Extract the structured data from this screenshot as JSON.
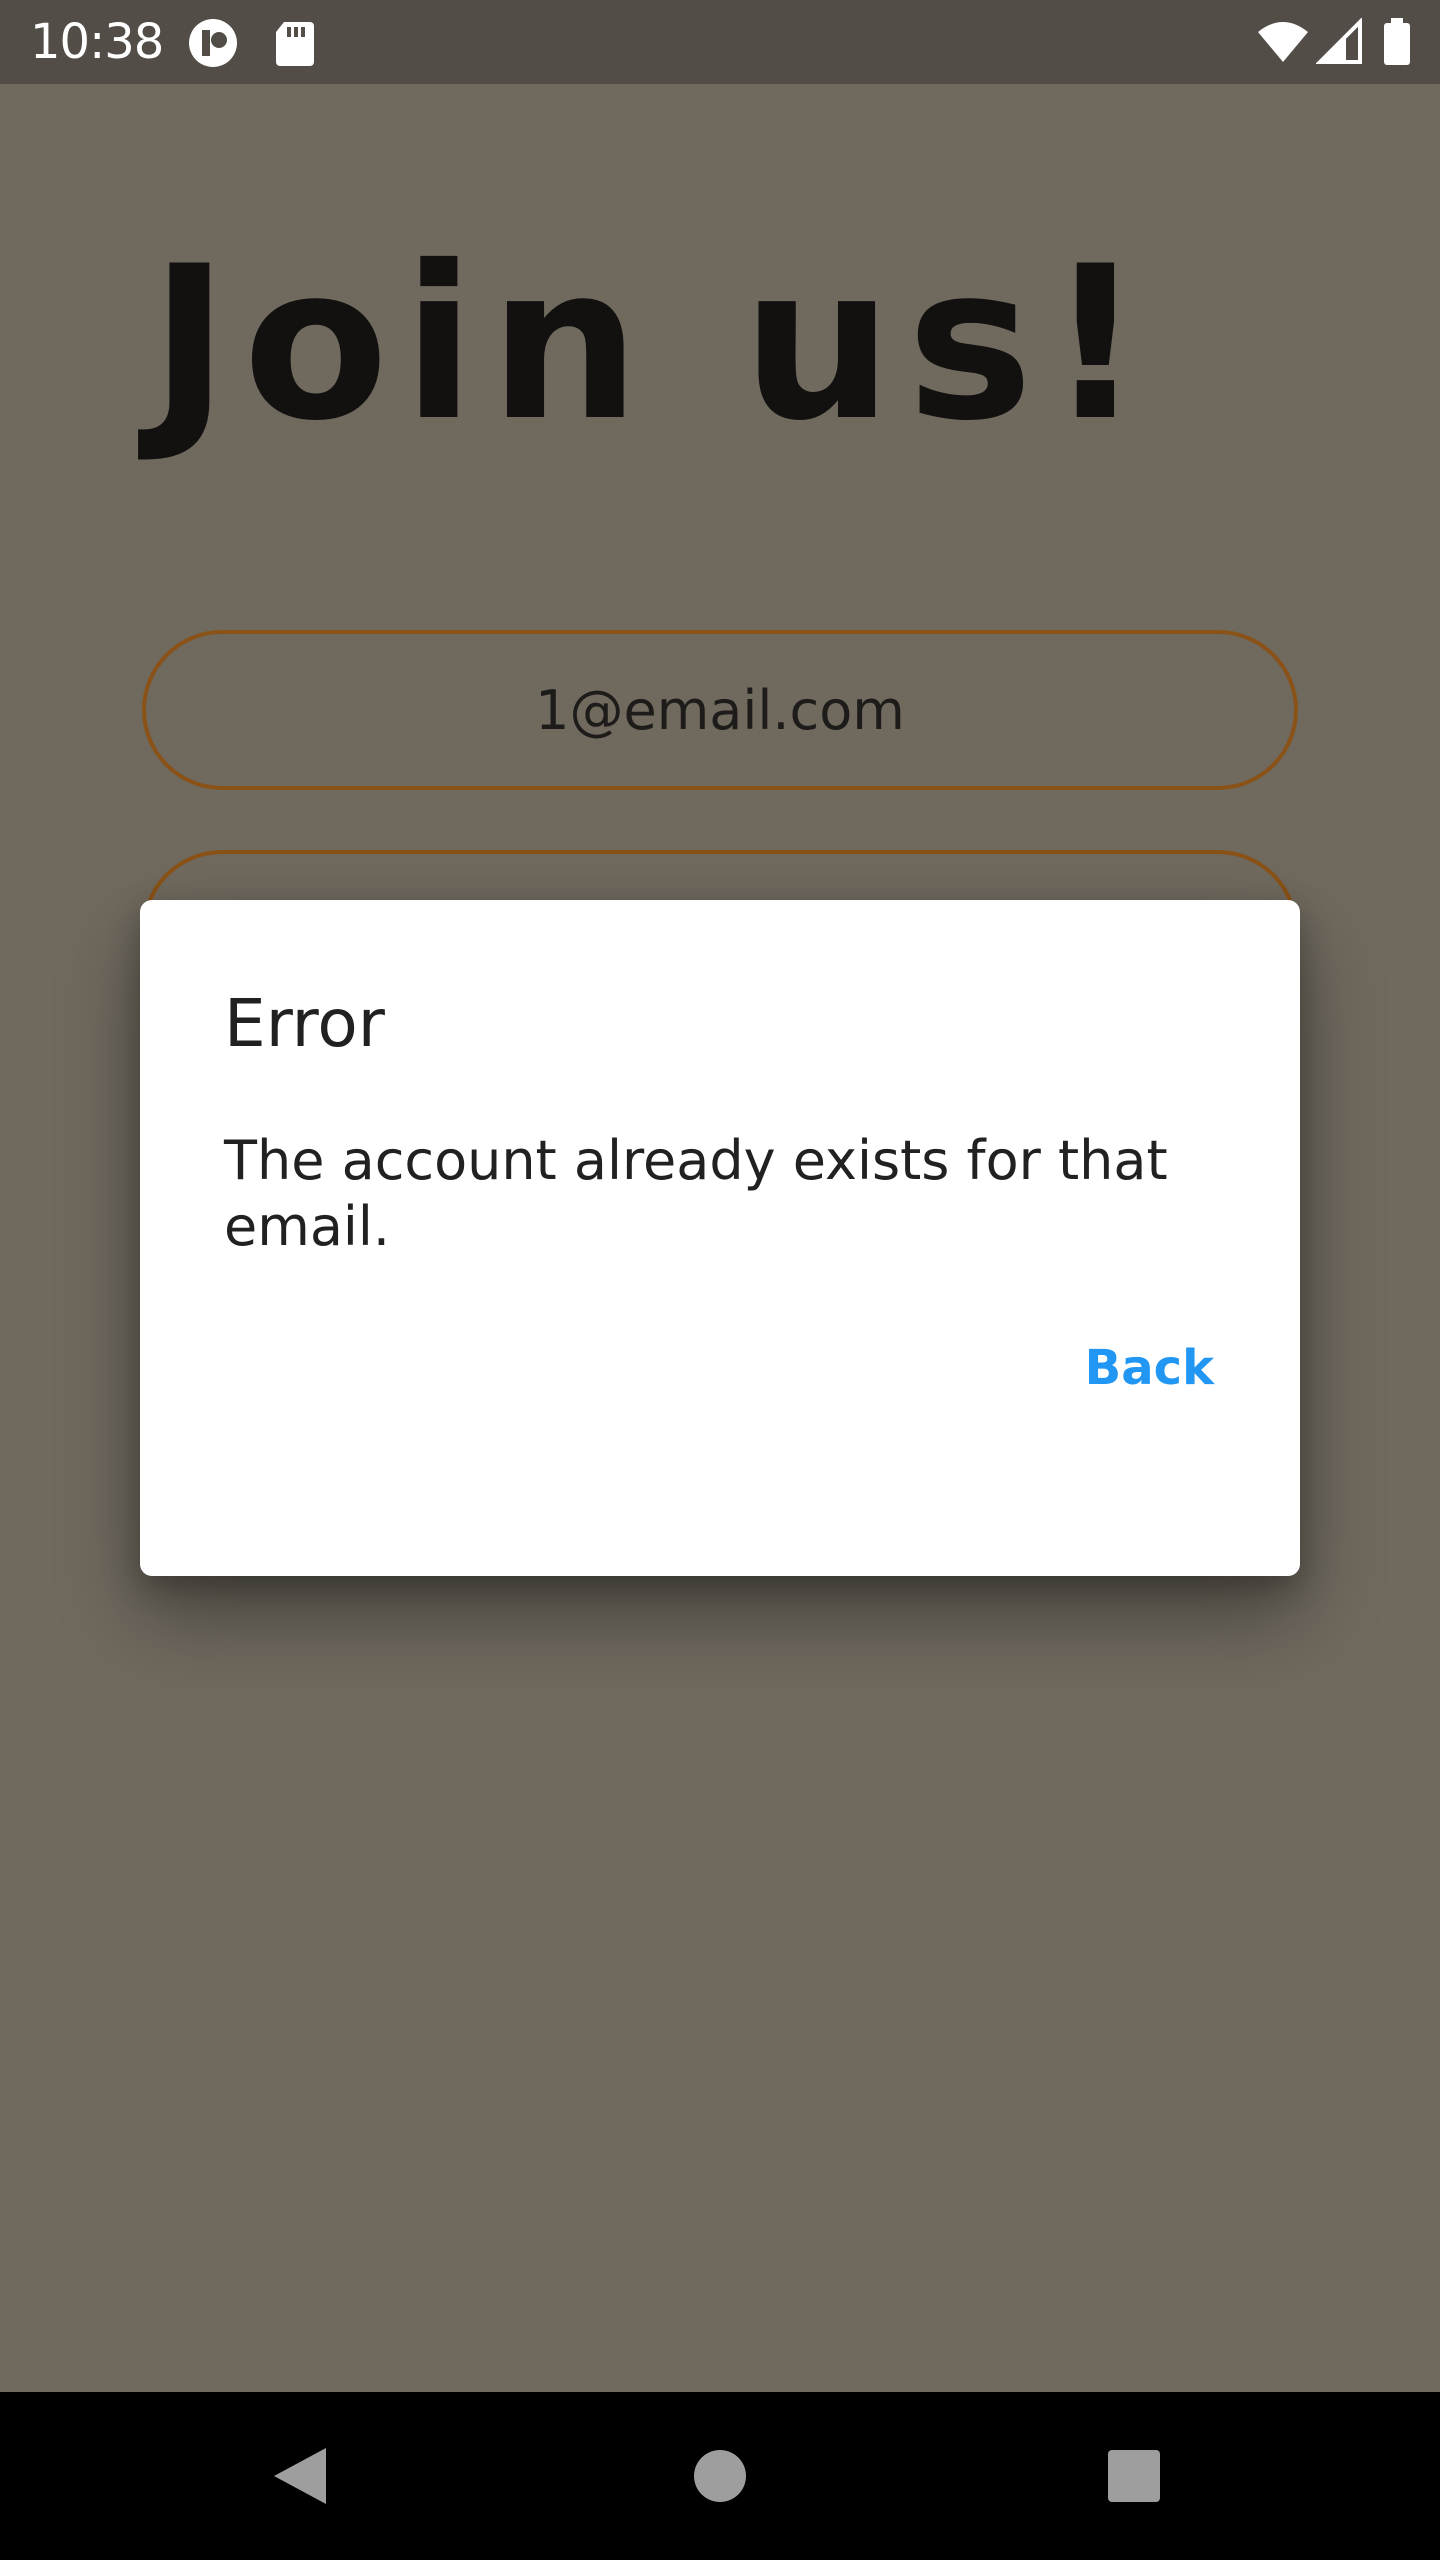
{
  "status_bar": {
    "time": "10:38",
    "icons": [
      "assistant-icon",
      "sd-card-icon",
      "wifi-icon",
      "cell-signal-icon",
      "battery-icon"
    ]
  },
  "page": {
    "title": "Join us!",
    "email_value": "1@email.com",
    "password_value": ""
  },
  "dialog": {
    "title": "Error",
    "message": "The account already exists for that email.",
    "button_label": "Back"
  },
  "nav_bar": {
    "icons": [
      "back-icon",
      "home-icon",
      "recents-icon"
    ]
  },
  "colors": {
    "accent": "#2196f3",
    "scrim_background": "#6f695e",
    "field_border": "#8a5216"
  }
}
